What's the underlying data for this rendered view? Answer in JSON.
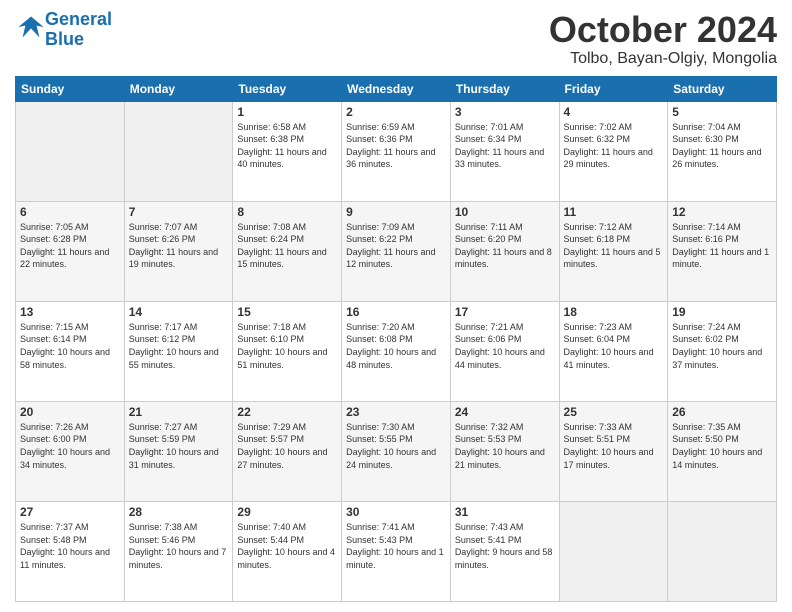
{
  "logo": {
    "line1": "General",
    "line2": "Blue"
  },
  "title": "October 2024",
  "location": "Tolbo, Bayan-Olgiy, Mongolia",
  "days_of_week": [
    "Sunday",
    "Monday",
    "Tuesday",
    "Wednesday",
    "Thursday",
    "Friday",
    "Saturday"
  ],
  "weeks": [
    [
      {
        "day": "",
        "info": ""
      },
      {
        "day": "",
        "info": ""
      },
      {
        "day": "1",
        "info": "Sunrise: 6:58 AM\nSunset: 6:38 PM\nDaylight: 11 hours and 40 minutes."
      },
      {
        "day": "2",
        "info": "Sunrise: 6:59 AM\nSunset: 6:36 PM\nDaylight: 11 hours and 36 minutes."
      },
      {
        "day": "3",
        "info": "Sunrise: 7:01 AM\nSunset: 6:34 PM\nDaylight: 11 hours and 33 minutes."
      },
      {
        "day": "4",
        "info": "Sunrise: 7:02 AM\nSunset: 6:32 PM\nDaylight: 11 hours and 29 minutes."
      },
      {
        "day": "5",
        "info": "Sunrise: 7:04 AM\nSunset: 6:30 PM\nDaylight: 11 hours and 26 minutes."
      }
    ],
    [
      {
        "day": "6",
        "info": "Sunrise: 7:05 AM\nSunset: 6:28 PM\nDaylight: 11 hours and 22 minutes."
      },
      {
        "day": "7",
        "info": "Sunrise: 7:07 AM\nSunset: 6:26 PM\nDaylight: 11 hours and 19 minutes."
      },
      {
        "day": "8",
        "info": "Sunrise: 7:08 AM\nSunset: 6:24 PM\nDaylight: 11 hours and 15 minutes."
      },
      {
        "day": "9",
        "info": "Sunrise: 7:09 AM\nSunset: 6:22 PM\nDaylight: 11 hours and 12 minutes."
      },
      {
        "day": "10",
        "info": "Sunrise: 7:11 AM\nSunset: 6:20 PM\nDaylight: 11 hours and 8 minutes."
      },
      {
        "day": "11",
        "info": "Sunrise: 7:12 AM\nSunset: 6:18 PM\nDaylight: 11 hours and 5 minutes."
      },
      {
        "day": "12",
        "info": "Sunrise: 7:14 AM\nSunset: 6:16 PM\nDaylight: 11 hours and 1 minute."
      }
    ],
    [
      {
        "day": "13",
        "info": "Sunrise: 7:15 AM\nSunset: 6:14 PM\nDaylight: 10 hours and 58 minutes."
      },
      {
        "day": "14",
        "info": "Sunrise: 7:17 AM\nSunset: 6:12 PM\nDaylight: 10 hours and 55 minutes."
      },
      {
        "day": "15",
        "info": "Sunrise: 7:18 AM\nSunset: 6:10 PM\nDaylight: 10 hours and 51 minutes."
      },
      {
        "day": "16",
        "info": "Sunrise: 7:20 AM\nSunset: 6:08 PM\nDaylight: 10 hours and 48 minutes."
      },
      {
        "day": "17",
        "info": "Sunrise: 7:21 AM\nSunset: 6:06 PM\nDaylight: 10 hours and 44 minutes."
      },
      {
        "day": "18",
        "info": "Sunrise: 7:23 AM\nSunset: 6:04 PM\nDaylight: 10 hours and 41 minutes."
      },
      {
        "day": "19",
        "info": "Sunrise: 7:24 AM\nSunset: 6:02 PM\nDaylight: 10 hours and 37 minutes."
      }
    ],
    [
      {
        "day": "20",
        "info": "Sunrise: 7:26 AM\nSunset: 6:00 PM\nDaylight: 10 hours and 34 minutes."
      },
      {
        "day": "21",
        "info": "Sunrise: 7:27 AM\nSunset: 5:59 PM\nDaylight: 10 hours and 31 minutes."
      },
      {
        "day": "22",
        "info": "Sunrise: 7:29 AM\nSunset: 5:57 PM\nDaylight: 10 hours and 27 minutes."
      },
      {
        "day": "23",
        "info": "Sunrise: 7:30 AM\nSunset: 5:55 PM\nDaylight: 10 hours and 24 minutes."
      },
      {
        "day": "24",
        "info": "Sunrise: 7:32 AM\nSunset: 5:53 PM\nDaylight: 10 hours and 21 minutes."
      },
      {
        "day": "25",
        "info": "Sunrise: 7:33 AM\nSunset: 5:51 PM\nDaylight: 10 hours and 17 minutes."
      },
      {
        "day": "26",
        "info": "Sunrise: 7:35 AM\nSunset: 5:50 PM\nDaylight: 10 hours and 14 minutes."
      }
    ],
    [
      {
        "day": "27",
        "info": "Sunrise: 7:37 AM\nSunset: 5:48 PM\nDaylight: 10 hours and 11 minutes."
      },
      {
        "day": "28",
        "info": "Sunrise: 7:38 AM\nSunset: 5:46 PM\nDaylight: 10 hours and 7 minutes."
      },
      {
        "day": "29",
        "info": "Sunrise: 7:40 AM\nSunset: 5:44 PM\nDaylight: 10 hours and 4 minutes."
      },
      {
        "day": "30",
        "info": "Sunrise: 7:41 AM\nSunset: 5:43 PM\nDaylight: 10 hours and 1 minute."
      },
      {
        "day": "31",
        "info": "Sunrise: 7:43 AM\nSunset: 5:41 PM\nDaylight: 9 hours and 58 minutes."
      },
      {
        "day": "",
        "info": ""
      },
      {
        "day": "",
        "info": ""
      }
    ]
  ]
}
